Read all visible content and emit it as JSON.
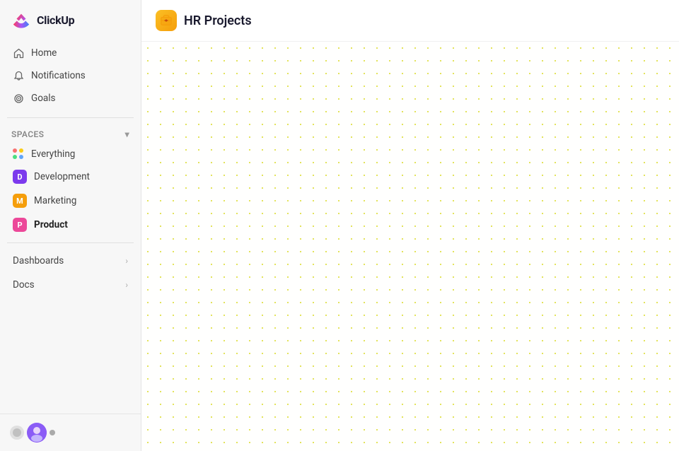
{
  "app": {
    "name": "ClickUp"
  },
  "sidebar": {
    "logo_text": "ClickUp",
    "nav_items": [
      {
        "id": "home",
        "label": "Home",
        "icon": "home"
      },
      {
        "id": "notifications",
        "label": "Notifications",
        "icon": "bell"
      },
      {
        "id": "goals",
        "label": "Goals",
        "icon": "target"
      }
    ],
    "spaces_header": "Spaces",
    "spaces_items": [
      {
        "id": "everything",
        "label": "Everything",
        "type": "grid"
      },
      {
        "id": "development",
        "label": "Development",
        "type": "avatar",
        "color": "#7c3aed",
        "initials": "D"
      },
      {
        "id": "marketing",
        "label": "Marketing",
        "type": "avatar",
        "color": "#f59e0b",
        "initials": "M"
      },
      {
        "id": "product",
        "label": "Product",
        "type": "avatar",
        "color": "#ec4899",
        "initials": "P",
        "active": true
      }
    ],
    "section_items": [
      {
        "id": "dashboards",
        "label": "Dashboards"
      },
      {
        "id": "docs",
        "label": "Docs"
      }
    ]
  },
  "main": {
    "project_icon": "📦",
    "page_title": "HR Projects"
  }
}
